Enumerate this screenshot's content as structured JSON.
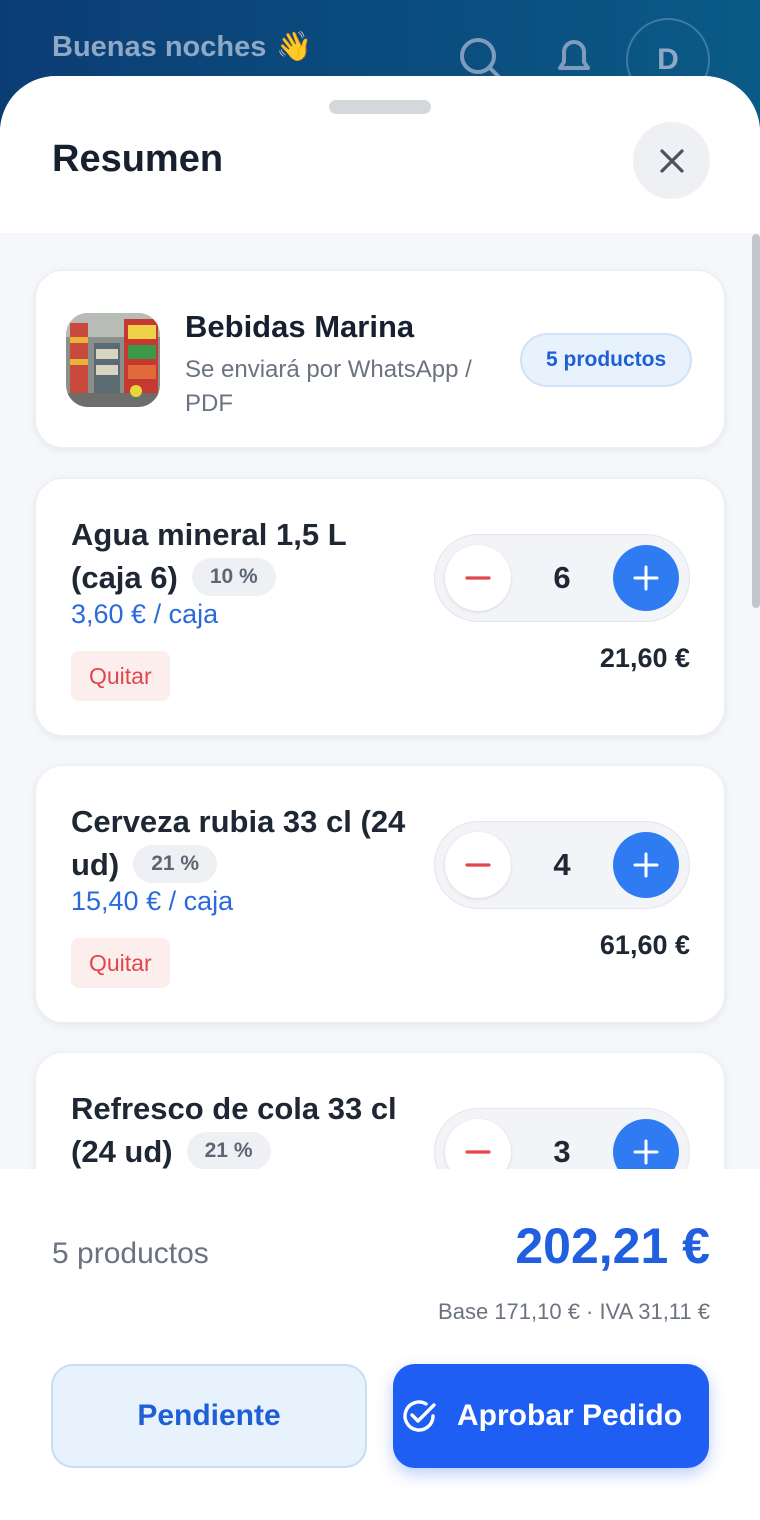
{
  "background": {
    "greeting": "Buenas noches",
    "greeting_emoji": "👋",
    "avatar_initial": "D"
  },
  "sheet": {
    "title": "Resumen"
  },
  "supplier": {
    "name": "Bebidas Marina",
    "subtitle": "Se enviará por WhatsApp / PDF",
    "badge": "5 productos"
  },
  "products": [
    {
      "name": "Agua mineral 1,5 L (caja 6)",
      "vat": "10 %",
      "price": "3,60 € / caja",
      "quantity": "6",
      "total": "21,60 €",
      "remove_label": "Quitar"
    },
    {
      "name": "Cerveza rubia 33 cl (24 ud)",
      "vat": "21 %",
      "price": "15,40 € / caja",
      "quantity": "4",
      "total": "61,60 €",
      "remove_label": "Quitar"
    },
    {
      "name": "Refresco de cola 33 cl (24 ud)",
      "vat": "21 %",
      "quantity": "3"
    }
  ],
  "footer": {
    "count": "5 productos",
    "total": "202,21 €",
    "breakdown": "Base 171,10 € · IVA 31,11 €",
    "pending_label": "Pendiente",
    "approve_label": "Aprobar Pedido"
  },
  "colors": {
    "accent": "#1e5ef3",
    "plus_button": "#2f7cf2",
    "remove": "#e0474c",
    "price": "#2a6bdc"
  }
}
